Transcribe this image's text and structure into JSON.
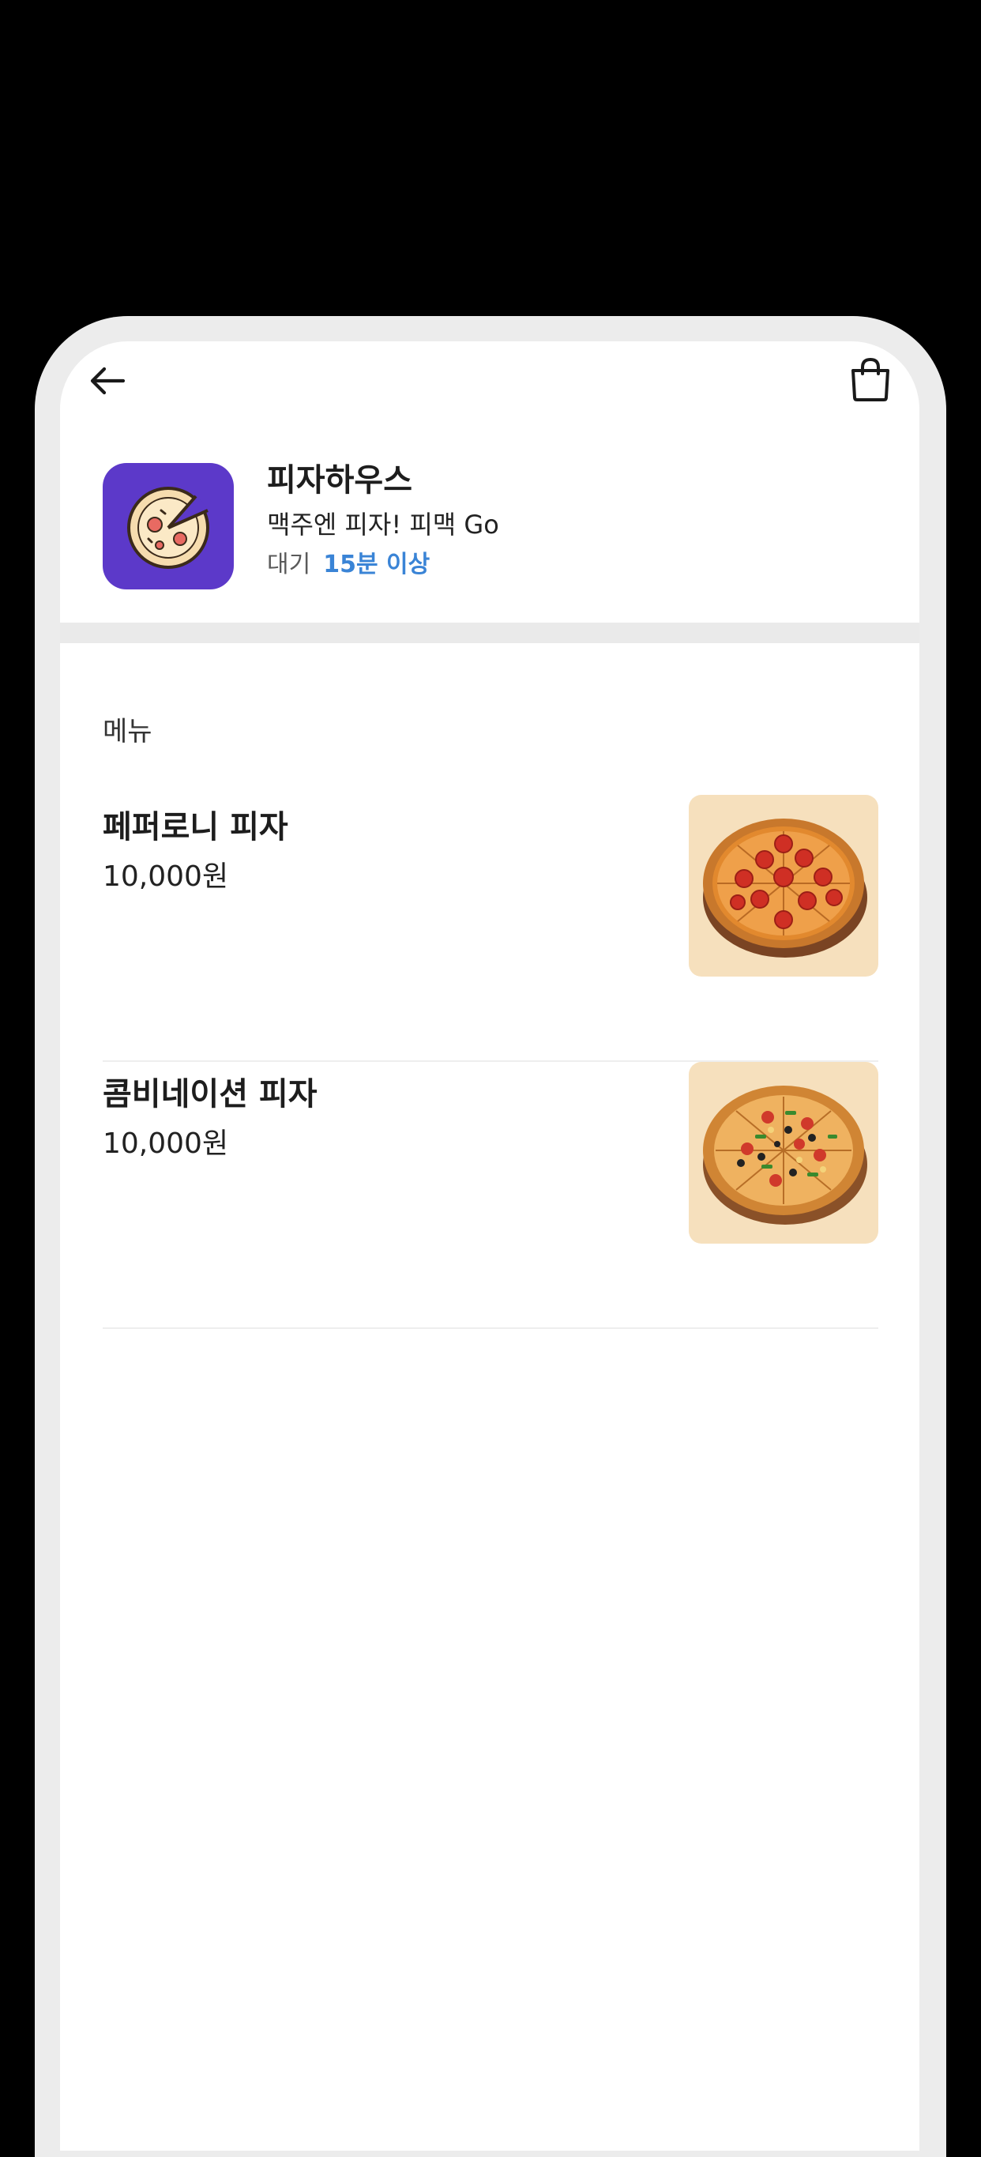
{
  "top_bar": {
    "back_icon": "back-arrow-icon",
    "cart_icon": "shopping-bag-icon"
  },
  "store": {
    "name": "피자하우스",
    "tagline": "맥주엔 피자! 피맥 Go",
    "wait_label": "대기",
    "wait_time": "15분 이상",
    "logo_icon": "pizza-slice-logo-icon",
    "colors": {
      "logo_background": "#5c39c9",
      "wait_accent": "#3a84d6"
    }
  },
  "menu": {
    "section_title": "메뉴",
    "items": [
      {
        "name": "페퍼로니 피자",
        "price": "10,000원",
        "image_icon": "pepperoni-pizza-image"
      },
      {
        "name": "콤비네이션 피자",
        "price": "10,000원",
        "image_icon": "combination-pizza-image"
      }
    ]
  }
}
